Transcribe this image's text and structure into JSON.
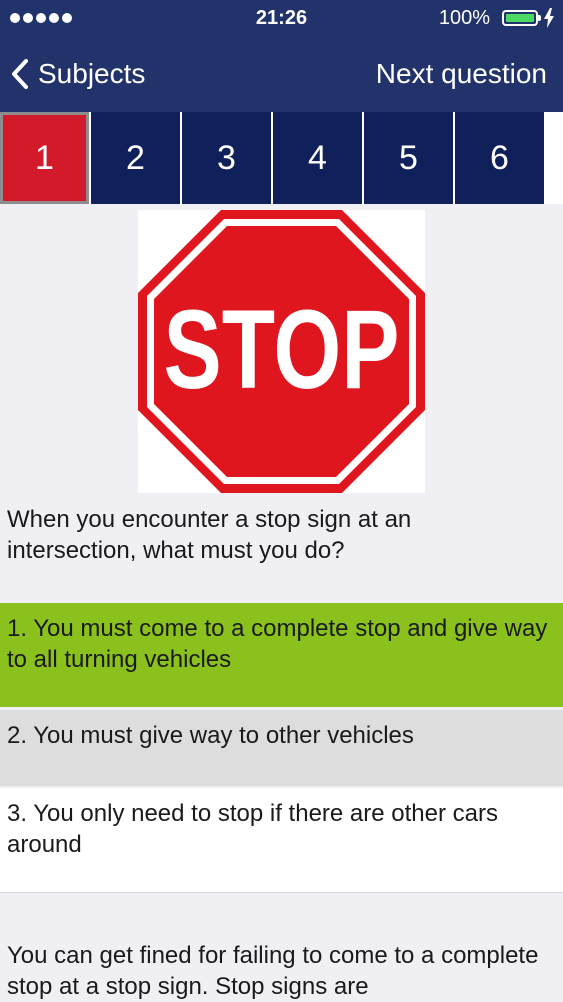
{
  "status_bar": {
    "time": "21:26",
    "battery_percent": "100%",
    "battery_level": 1.0,
    "signal_dots": 5,
    "charging_icon": "lightning-bolt-icon"
  },
  "nav": {
    "back_label": "Subjects",
    "back_icon": "chevron-left-icon",
    "next_label": "Next question",
    "background_color": "#22336b"
  },
  "tabs": {
    "items": [
      "1",
      "2",
      "3",
      "4",
      "5",
      "6"
    ],
    "active_index": 0,
    "active_color": "#d21a2a",
    "inactive_color": "#10205a"
  },
  "sign": {
    "text": "STOP",
    "color": "#e0161f"
  },
  "question": "When you encounter a stop sign at an intersection, what must you do?",
  "answers": [
    {
      "label": "1. You must come to a complete stop and give way to all turning vehicles",
      "state": "correct",
      "color": "#8ac11c"
    },
    {
      "label": "2. You must give way to other vehicles",
      "state": "neutral",
      "color": "#dddddd"
    },
    {
      "label": "3. You only need to stop if there are other cars around",
      "state": "neutral",
      "color": "#ffffff"
    }
  ],
  "explanation": "You can get fined for failing to come to a complete stop at a stop sign. Stop signs are"
}
